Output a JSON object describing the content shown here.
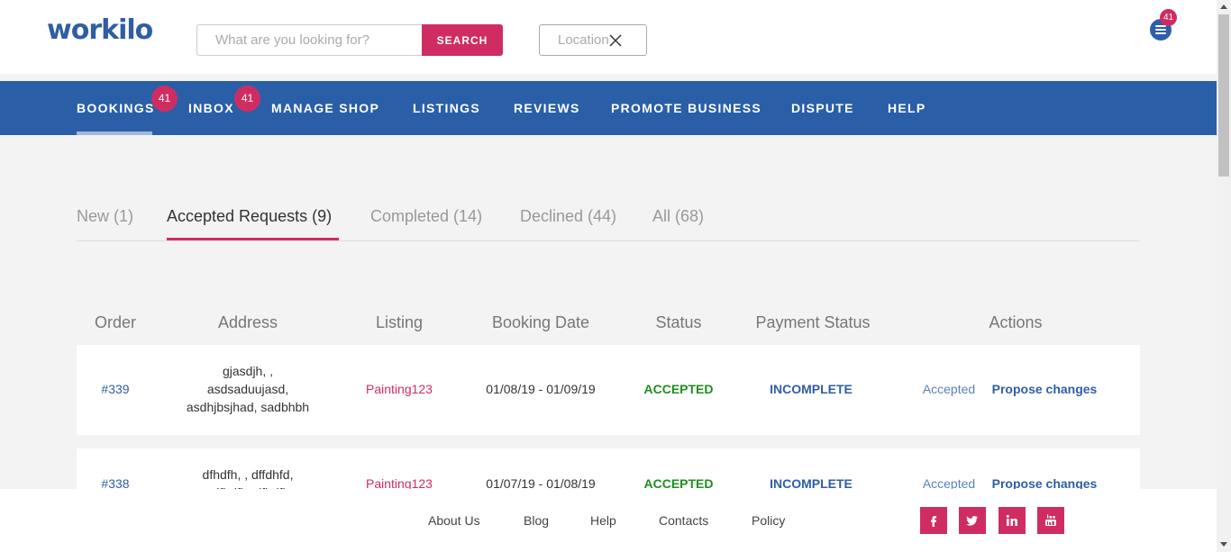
{
  "brand": {
    "logo": "workilo"
  },
  "search": {
    "placeholder": "What are you looking for?",
    "button": "SEARCH",
    "location_placeholder": "Location"
  },
  "header": {
    "menu_badge": "41"
  },
  "nav": {
    "items": [
      "BOOKINGS",
      "INBOX",
      "MANAGE SHOP",
      "LISTINGS",
      "REVIEWS",
      "PROMOTE BUSINESS",
      "DISPUTE",
      "HELP"
    ],
    "bookings_badge": "41",
    "inbox_badge": "41"
  },
  "tabs": [
    "New (1)",
    "Accepted Requests (9)",
    "Completed (14)",
    "Declined (44)",
    "All (68)"
  ],
  "table": {
    "headers": [
      "Order",
      "Address",
      "Listing",
      "Booking Date",
      "Status",
      "Payment Status",
      "Actions"
    ],
    "rows": [
      {
        "order": "#339",
        "address": [
          "gjasdjh, ,",
          "asdsaduujasd,",
          "asdhjbsjhad, sadbhbh"
        ],
        "listing": "Painting123",
        "date": "01/08/19 - 01/09/19",
        "status": "ACCEPTED",
        "payment": "INCOMPLETE",
        "action_state": "Accepted",
        "action_link": "Propose changes"
      },
      {
        "order": "#338",
        "address": [
          "dfhdfh, , dffdhfd,",
          "sdfhdfh, dfhdfh"
        ],
        "listing": "Painting123",
        "date": "01/07/19 - 01/08/19",
        "status": "ACCEPTED",
        "payment": "INCOMPLETE",
        "action_state": "Accepted",
        "action_link": "Propose changes"
      }
    ]
  },
  "footer": {
    "links": [
      "About Us",
      "Blog",
      "Help",
      "Contacts",
      "Policy"
    ],
    "social": [
      "facebook-icon",
      "twitter-icon",
      "linkedin-icon",
      "youtube-icon"
    ]
  },
  "colors": {
    "primary": "#2a5fa8",
    "accent": "#cf2d62",
    "success": "#1f8f1f"
  }
}
